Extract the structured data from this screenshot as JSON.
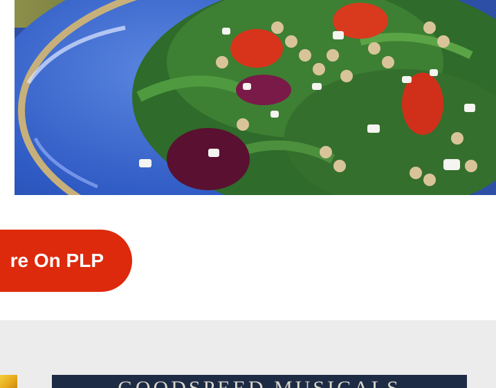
{
  "cta": {
    "label": "re On PLP",
    "color": "#dd2a0c"
  },
  "ad": {
    "banner_text": "GOODSPEED MUSICALS",
    "banner_bg": "#1e2b45"
  },
  "colors": {
    "band_bg": "#ececec",
    "bowl_blue": "#2f5bc4"
  }
}
